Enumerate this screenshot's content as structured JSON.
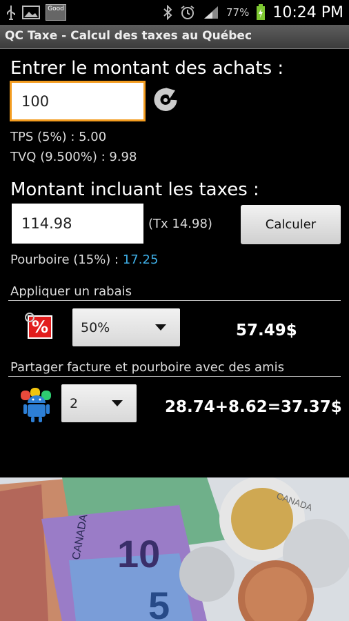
{
  "status_bar": {
    "notif_badge": "Good",
    "battery_pct": "77%",
    "clock": "10:24 PM"
  },
  "app": {
    "title": "QC Taxe - Calcul des taxes au Québec"
  },
  "purchase": {
    "label": "Entrer le montant des achats :",
    "amount": "100",
    "tps": "TPS (5%) : 5.00",
    "tvq": "TVQ (9.500%) : 9.98"
  },
  "total": {
    "label": "Montant incluant les taxes :",
    "amount": "114.98",
    "tax_note": "(Tx 14.98)",
    "calc_button": "Calculer",
    "tip_label": "Pourboire (15%) :",
    "tip_value": "17.25"
  },
  "discount": {
    "section_label": "Appliquer un rabais",
    "selected": "50%",
    "result": "57.49$",
    "icon_glyph": "%"
  },
  "share": {
    "section_label": "Partager facture et pourboire avec des amis",
    "selected": "2",
    "result": "28.74+8.62=37.37$"
  },
  "banner": {
    "notes": [
      "CANADA",
      "10",
      "5"
    ],
    "coin": "CANADA"
  },
  "colors": {
    "accent": "#f39c1f",
    "tip": "#3fb0e8",
    "title_bar": "#4a4a4a"
  }
}
